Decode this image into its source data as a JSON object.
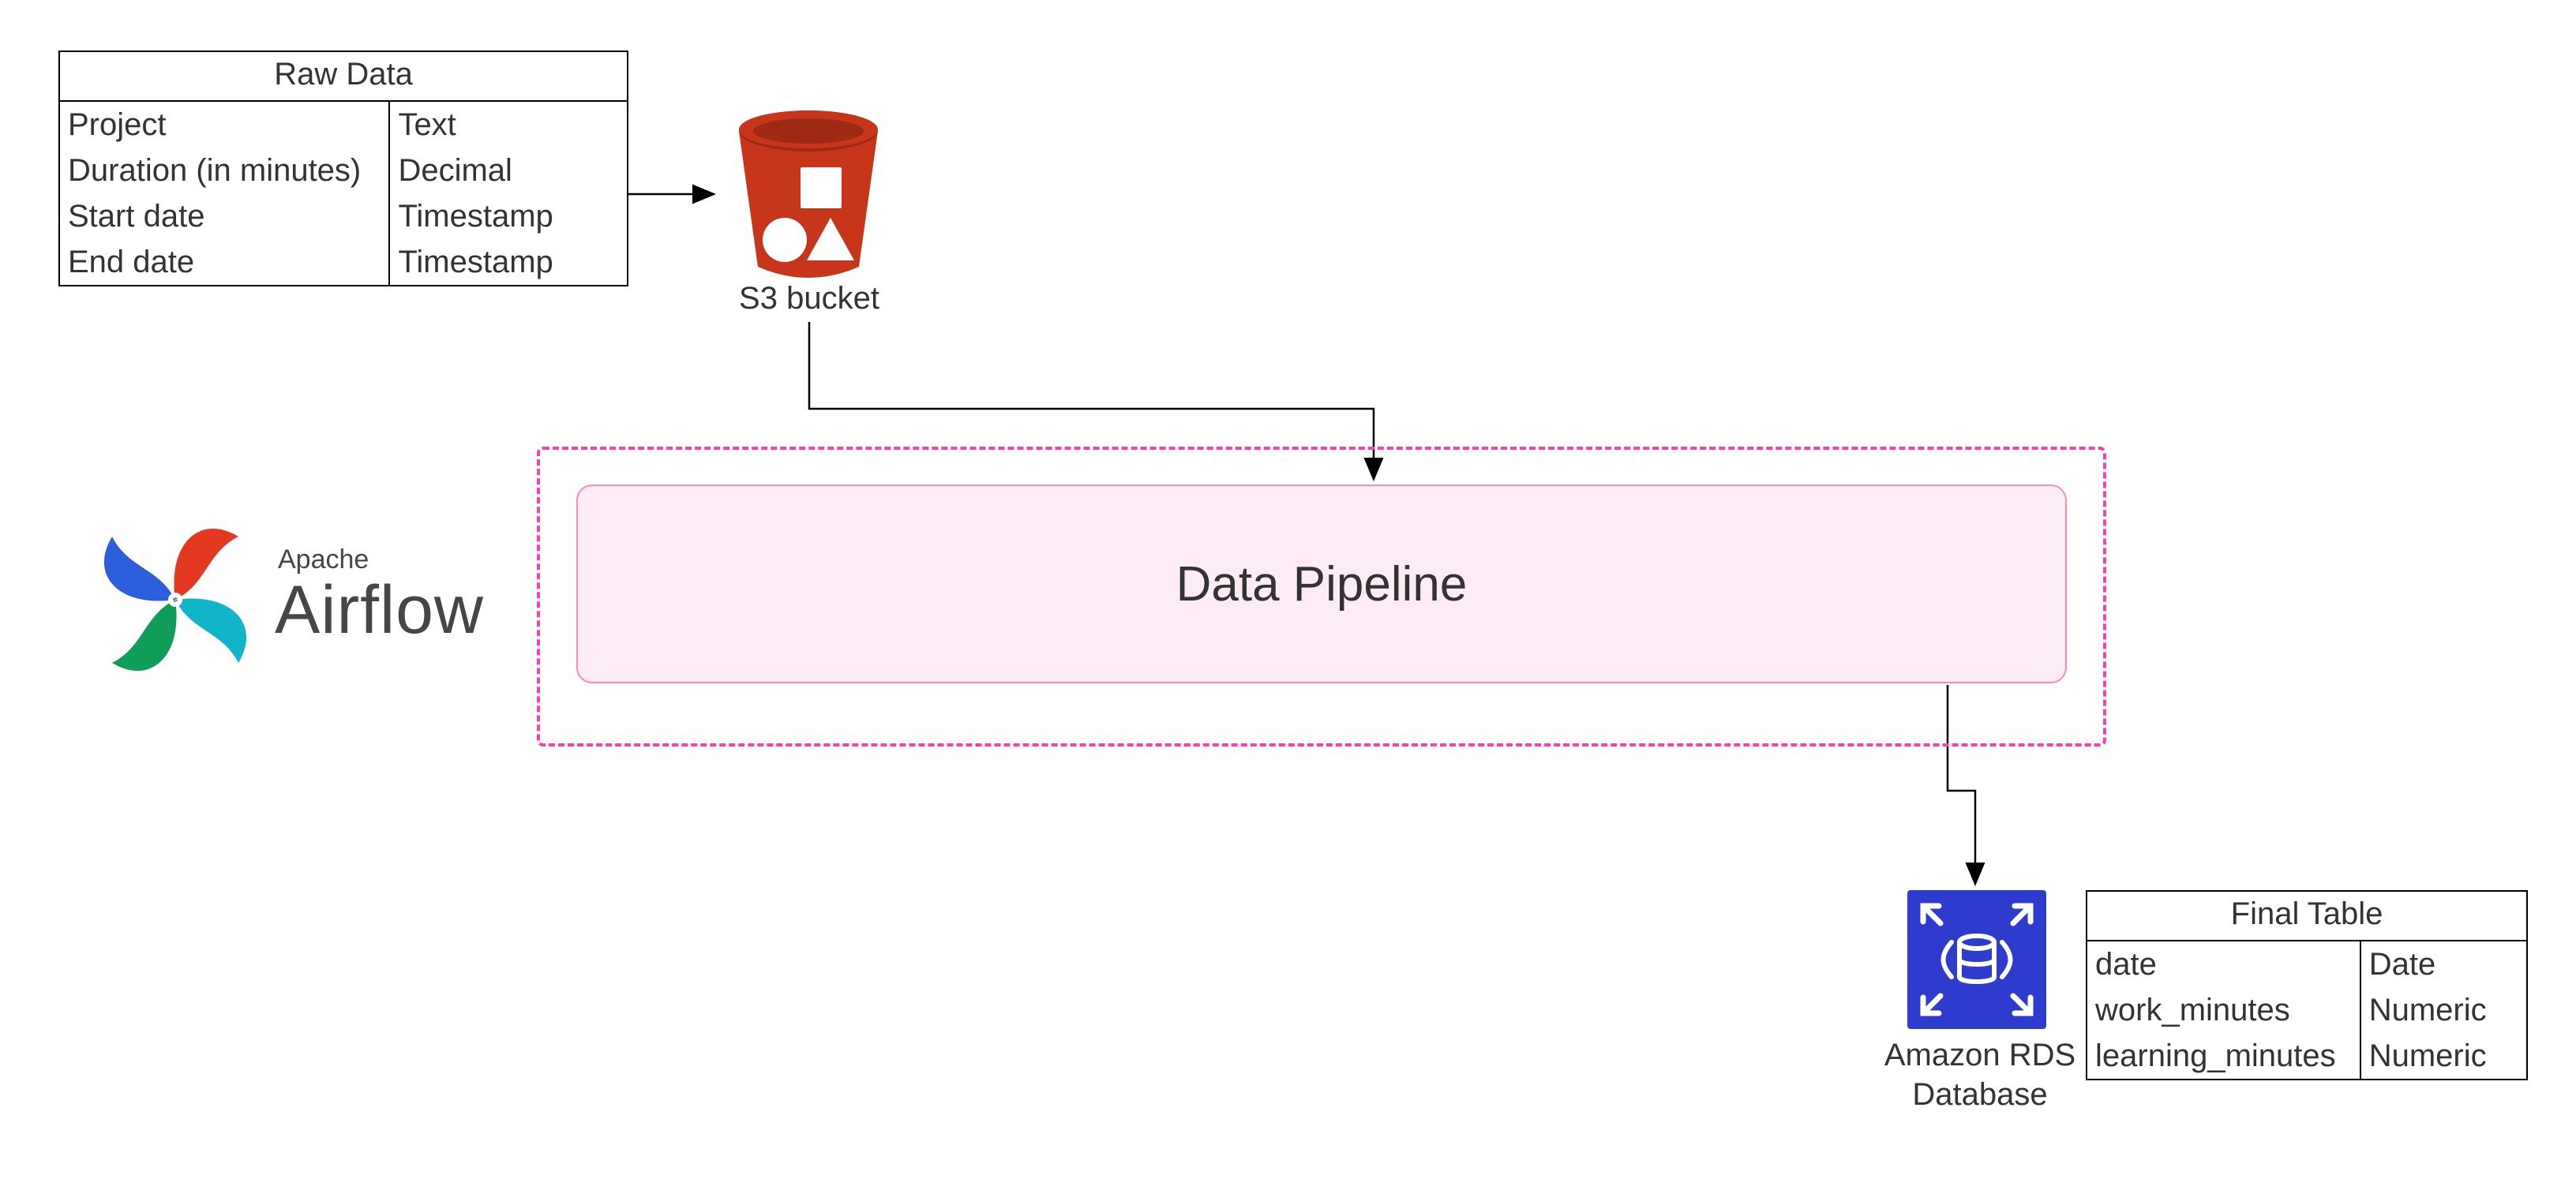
{
  "raw_table": {
    "title": "Raw Data",
    "rows": [
      {
        "field": "Project",
        "type": "Text"
      },
      {
        "field": "Duration (in minutes)",
        "type": "Decimal"
      },
      {
        "field": "Start date",
        "type": "Timestamp"
      },
      {
        "field": "End date",
        "type": "Timestamp"
      }
    ]
  },
  "s3": {
    "label": "S3 bucket"
  },
  "pipeline": {
    "label": "Data Pipeline"
  },
  "airflow": {
    "brand_small": "Apache",
    "brand_big": "Airflow"
  },
  "rds": {
    "label_line1": "Amazon RDS",
    "label_line2": "Database"
  },
  "final_table": {
    "title": "Final Table",
    "rows": [
      {
        "field": "date",
        "type": "Date"
      },
      {
        "field": "work_minutes",
        "type": "Numeric"
      },
      {
        "field": "learning_minutes",
        "type": "Numeric"
      }
    ]
  }
}
